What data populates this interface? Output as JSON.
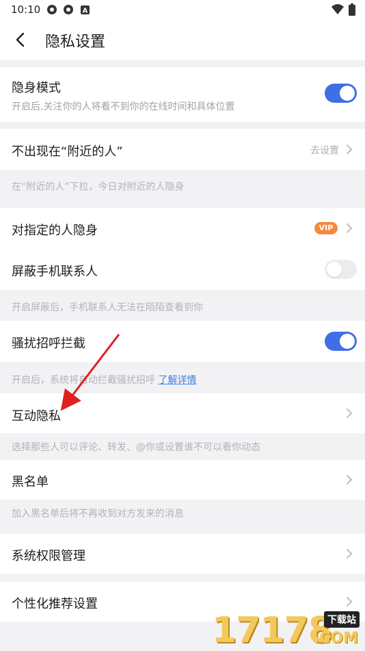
{
  "status_bar": {
    "time": "10:10",
    "icons": [
      "app-icon",
      "app-icon",
      "notification-a-icon"
    ],
    "right_icons": [
      "wifi-icon",
      "battery-icon"
    ]
  },
  "nav": {
    "title": "隐私设置",
    "back_icon": "chevron-left-icon"
  },
  "rows": {
    "stealth": {
      "label": "隐身模式",
      "sub": "开启后,关注你的人将看不到你的在线时间和具体位置",
      "toggle": "on"
    },
    "nearby": {
      "label": "不出现在“附近的人”",
      "hint": "去设置",
      "note": "在“附近的人”下拉，今日对附近的人隐身"
    },
    "specific": {
      "label": "对指定的人隐身",
      "badge": "VIP"
    },
    "contacts": {
      "label": "屏蔽手机联系人",
      "toggle": "off",
      "note": "开启屏蔽后，手机联系人无法在陌陌查看到你"
    },
    "harass": {
      "label": "骚扰招呼拦截",
      "toggle": "on",
      "note": "开启后，系统将自动拦截骚扰招呼",
      "note_link": "了解详情"
    },
    "interaction": {
      "label": "互动隐私",
      "note": "选择那些人可以评论、转发、@你或设置谁不可以看你动态"
    },
    "blacklist": {
      "label": "黑名单",
      "note": "加入黑名单后将不再收到对方发来的消息"
    },
    "permissions": {
      "label": "系统权限管理"
    },
    "personalized": {
      "label": "个性化推荐设置"
    }
  },
  "colors": {
    "toggle_on": "#3f6fe6",
    "link": "#3b7ee8",
    "vip": "#f6893f",
    "annotation_arrow": "#e02020"
  },
  "watermark": {
    "digits": "17178",
    "tag": "下载站",
    "suffix": ".COM"
  }
}
